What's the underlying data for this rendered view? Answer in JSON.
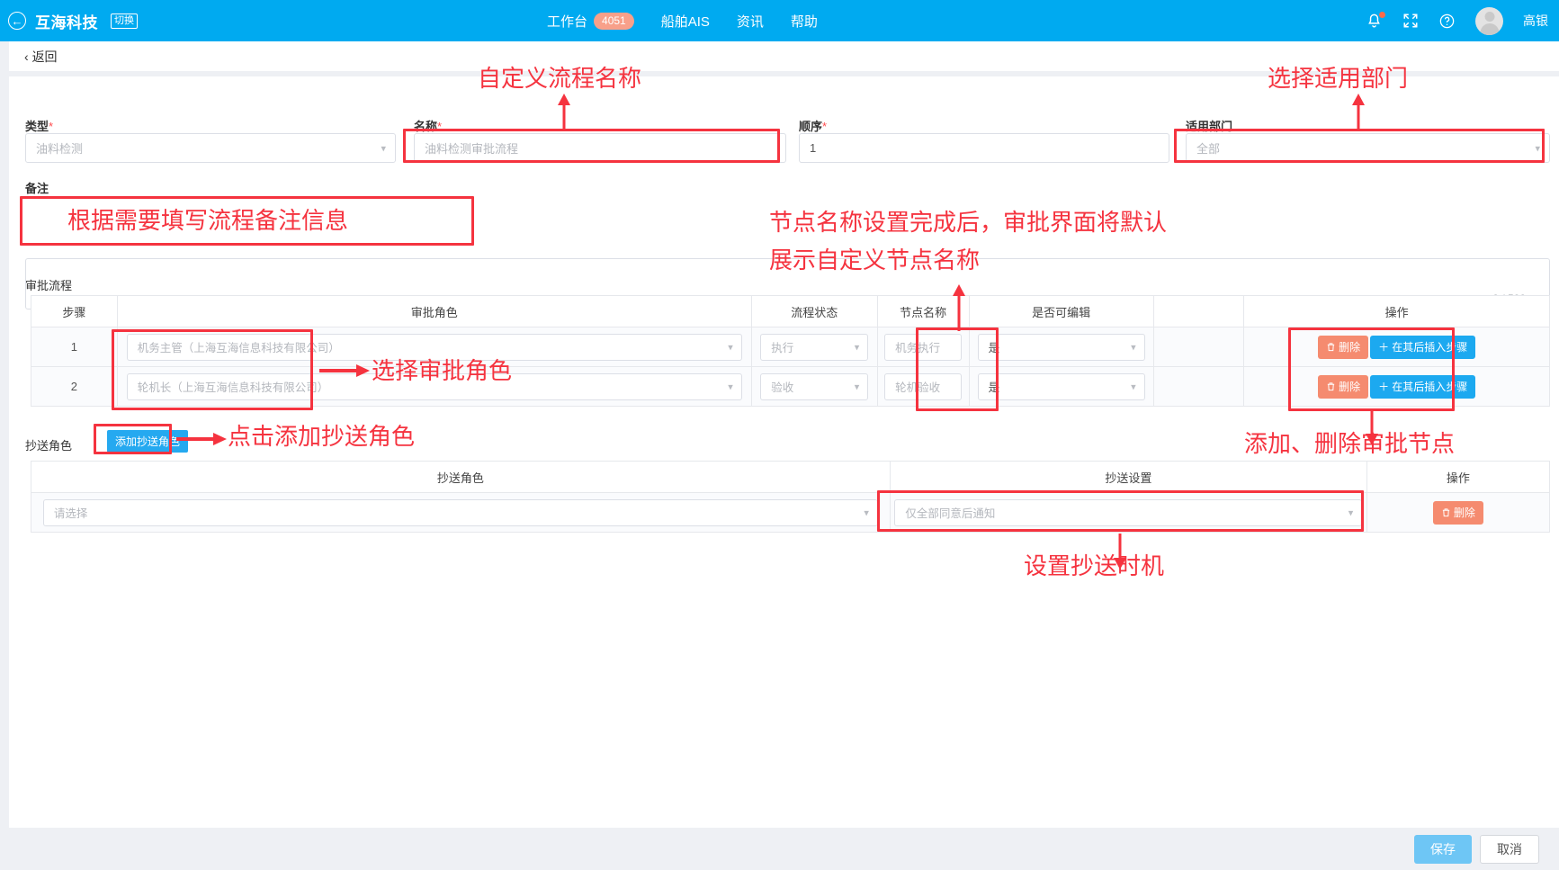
{
  "header": {
    "back_icon": "back-arrow-circle-icon",
    "brand": "互海科技",
    "switch_badge": "切换",
    "nav": [
      {
        "label": "工作台",
        "badge": "4051"
      },
      {
        "label": "船舶AIS",
        "badge": ""
      },
      {
        "label": "资讯",
        "badge": ""
      },
      {
        "label": "帮助",
        "badge": ""
      }
    ],
    "icons": [
      "bell-icon",
      "fullscreen-icon",
      "help-icon"
    ],
    "user_name": "高银",
    "bg_color": "#00aaf0",
    "badge_color": "#f8a08a"
  },
  "backbar": {
    "label": "返回"
  },
  "form": {
    "type_label": "类型",
    "type_value": "油料检测",
    "name_label": "名称",
    "name_value": "油料检测审批流程",
    "order_label": "顺序",
    "order_value": "1",
    "dept_label": "适用部门",
    "dept_value": "全部",
    "remark_label": "备注",
    "remark_value": "",
    "remark_counter": "0 / 500"
  },
  "approval": {
    "section_title": "审批流程",
    "columns": [
      "步骤",
      "审批角色",
      "流程状态",
      "节点名称",
      "是否可编辑",
      "",
      "操作"
    ],
    "rows": [
      {
        "step": "1",
        "role": "机务主管（上海互海信息科技有限公司）",
        "status": "执行",
        "node_name": "机务执行",
        "editable": "是",
        "blank": "",
        "delete_label": "删除",
        "insert_label": "在其后插入步骤"
      },
      {
        "step": "2",
        "role": "轮机长（上海互海信息科技有限公司）",
        "status": "验收",
        "node_name": "轮机验收",
        "editable": "是",
        "blank": "",
        "delete_label": "删除",
        "insert_label": "在其后插入步骤"
      }
    ]
  },
  "cc": {
    "section_title": "抄送角色",
    "add_button": "添加抄送角色",
    "columns": [
      "抄送角色",
      "抄送设置",
      "操作"
    ],
    "rows": [
      {
        "role": "请选择",
        "setting": "仅全部同意后通知",
        "delete_label": "删除"
      }
    ]
  },
  "footer": {
    "save_label": "保存",
    "cancel_label": "取消"
  },
  "annotations": [
    {
      "id": "a1",
      "text": "自定义流程名称"
    },
    {
      "id": "a2",
      "text": "选择适用部门"
    },
    {
      "id": "a3",
      "text": "根据需要填写流程备注信息"
    },
    {
      "id": "a4",
      "text": "节点名称设置完成后，审批界面将默认"
    },
    {
      "id": "a5",
      "text": "展示自定义节点名称"
    },
    {
      "id": "a6",
      "text": "选择审批角色"
    },
    {
      "id": "a7",
      "text": "添加、删除审批节点"
    },
    {
      "id": "a8",
      "text": "点击添加抄送角色"
    },
    {
      "id": "a9",
      "text": "设置抄送时机"
    }
  ],
  "colors": {
    "accent": "#00aaf0",
    "annotation": "#f5333f",
    "delete_button": "#f58b6f",
    "insert_button": "#1ca9f0"
  }
}
